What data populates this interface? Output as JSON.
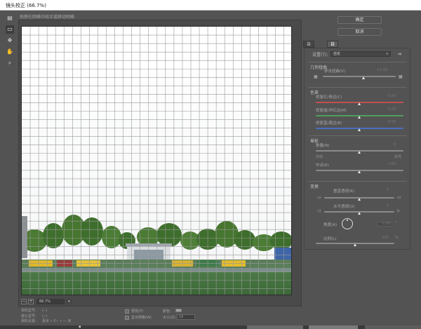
{
  "window": {
    "title": "镜头校正 (66.7%)"
  },
  "hint": "拖移在网格中校正或移动网格",
  "tools": [
    {
      "icon": "remove-distortion-icon",
      "glyph": "▤",
      "active": false
    },
    {
      "icon": "straighten-icon",
      "glyph": "▭",
      "active": true
    },
    {
      "icon": "move-grid-icon",
      "glyph": "✥",
      "active": false
    },
    {
      "icon": "hand-icon",
      "glyph": "✋",
      "active": false
    },
    {
      "icon": "zoom-icon",
      "glyph": "⌕",
      "active": false
    }
  ],
  "buttons": {
    "ok": "确定",
    "cancel": "取消"
  },
  "tabs": [
    {
      "label": "自动校正",
      "active": false
    },
    {
      "label": "自定",
      "active": true
    }
  ],
  "settings": {
    "label": "设置(T):",
    "value": "自定"
  },
  "geometry": {
    "title": "几何扭曲",
    "label": "移去扭曲(V)",
    "value": "+5.00",
    "level": 0.56
  },
  "chromatic": {
    "title": "色差",
    "rows": [
      {
        "label": "修复红/青边(C)",
        "value": "0.00",
        "level": 0.5
      },
      {
        "label": "修复绿/洋红边(M)",
        "value": "0.00",
        "level": 0.5
      },
      {
        "label": "修复蓝/黄边(B)",
        "value": "0.00",
        "level": 0.5
      }
    ]
  },
  "vignette": {
    "title": "晕影",
    "amount_label": "数量(N)",
    "amount_value": "0",
    "amount_level": 0.5,
    "dark": "变暗",
    "light": "变亮",
    "mid_label": "中点(K)",
    "mid_value": "+50",
    "mid_level": 0.5
  },
  "transform": {
    "title": "变换",
    "vert_label": "垂直透视(R)",
    "vert_value": "0",
    "vert_level": 0.5,
    "horiz_label": "水平透视(O)",
    "horiz_value": "0",
    "horiz_level": 0.5,
    "angle_label": "角度(A)",
    "angle_value": "0.00",
    "angle_unit": "°",
    "scale_label": "比例(L)",
    "scale_value": "100",
    "scale_unit": "%",
    "scale_level": 0.5
  },
  "zoom": {
    "minus": "−",
    "plus": "+",
    "value": "66.7%"
  },
  "info": {
    "rows": [
      {
        "label": "相机型号:",
        "value": "(--)"
      },
      {
        "label": "镜头型号:",
        "value": "(--)"
      },
      {
        "label": "相机设置:",
        "value": "毫米 ∙ f/-- ∙ --: 米"
      }
    ]
  },
  "view": {
    "preview": "预览(P)",
    "show_grid": "显示网格(W)",
    "color": "颜色:",
    "size": "大小(Z):",
    "size_value": "16"
  },
  "colors": {
    "dialog": "#535353",
    "grid": "#9a9a9a",
    "track_red": "#c05050",
    "track_green": "#4f9e5a",
    "track_blue": "#4a6fc0",
    "track_gray": "#8a8a8a"
  }
}
